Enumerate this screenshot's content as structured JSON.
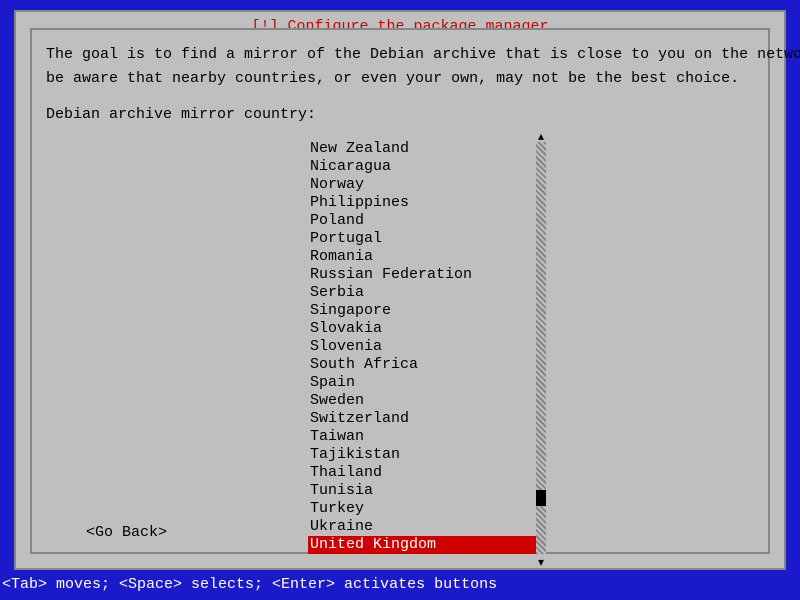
{
  "title": "[!] Configure the package manager",
  "goal_line1": "The goal is to find a mirror of the Debian archive that is close to you on the network --",
  "goal_line2": "be aware that nearby countries, or even your own, may not be the best choice.",
  "prompt": "Debian archive mirror country:",
  "countries": [
    "New Zealand",
    "Nicaragua",
    "Norway",
    "Philippines",
    "Poland",
    "Portugal",
    "Romania",
    "Russian Federation",
    "Serbia",
    "Singapore",
    "Slovakia",
    "Slovenia",
    "South Africa",
    "Spain",
    "Sweden",
    "Switzerland",
    "Taiwan",
    "Tajikistan",
    "Thailand",
    "Tunisia",
    "Turkey",
    "Ukraine",
    "United Kingdom"
  ],
  "selected_index": 22,
  "go_back": "<Go Back>",
  "hints": "<Tab> moves; <Space> selects; <Enter> activates buttons"
}
